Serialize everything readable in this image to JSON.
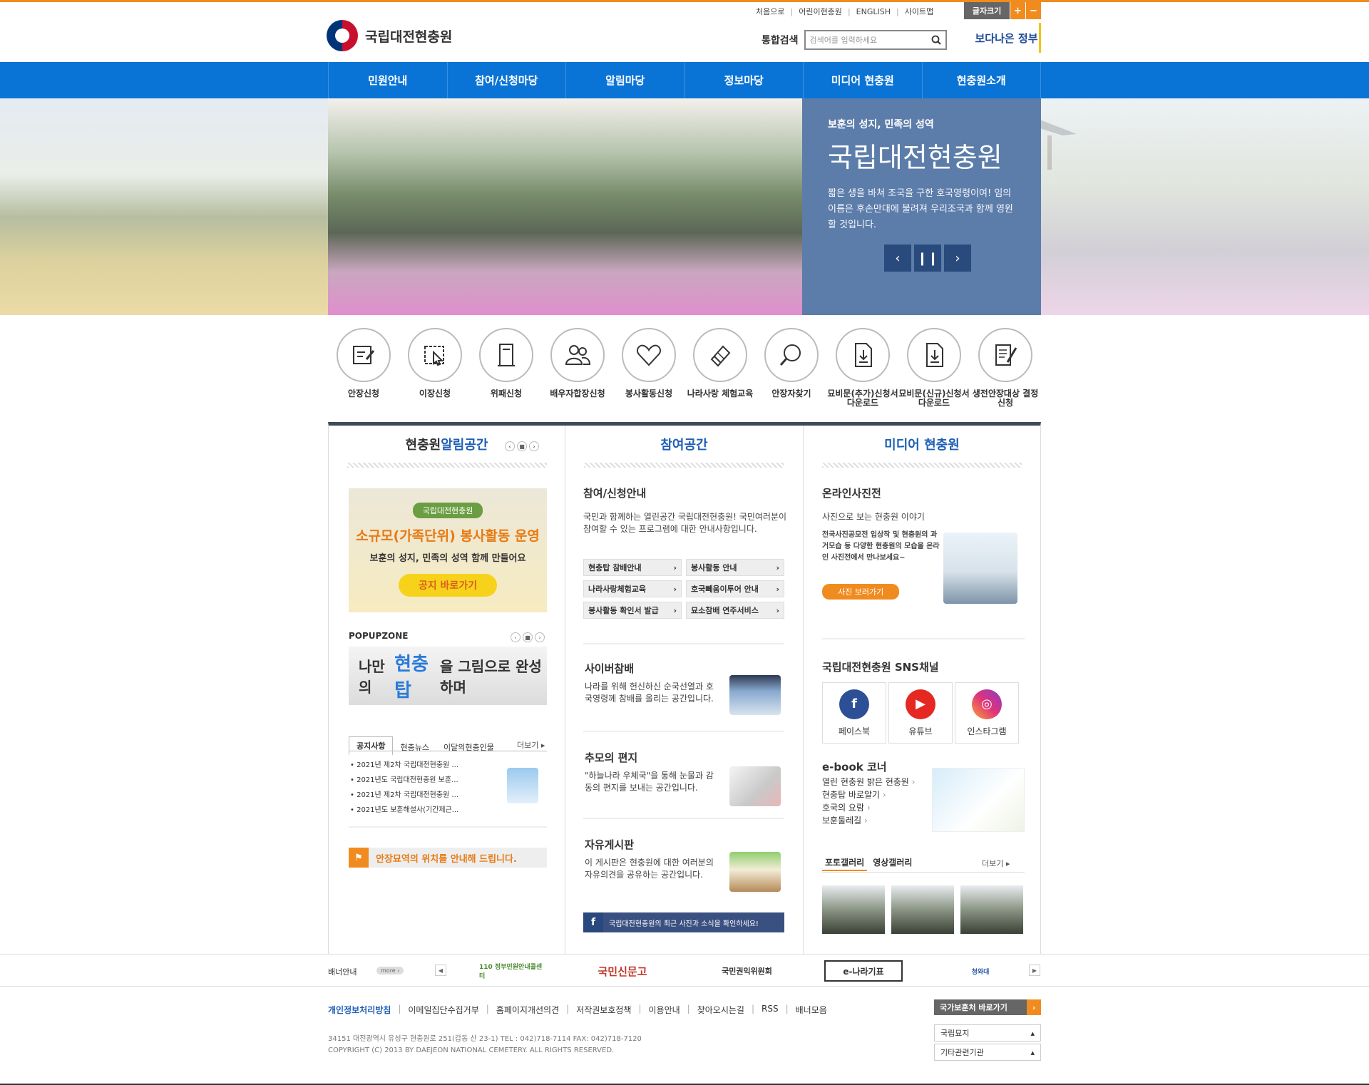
{
  "util": {
    "links": [
      "처음으로",
      "어린이현충원",
      "ENGLISH",
      "사이트맵"
    ],
    "font_size_label": "글자크기",
    "plus": "+",
    "minus": "−"
  },
  "site": {
    "name": "국립대전현충원"
  },
  "search": {
    "label": "통합검색",
    "placeholder": "검색어를 입력하세요"
  },
  "gov_badge": "보다나은 정부",
  "nav": [
    "민원안내",
    "참여/신청마당",
    "알림마당",
    "정보마당",
    "미디어 현충원",
    "현충원소개"
  ],
  "hero": {
    "subtitle": "보훈의 성지, 민족의 성역",
    "title": "국립대전현충원",
    "desc": "짧은 생을 바쳐 조국을 구한 호국영령이여! 임의 이름은 후손만대에 불려져 우리조국과 함께 영원할 것입니다.",
    "prev": "‹",
    "pause": "❙❙",
    "next": "›"
  },
  "quick_links": [
    "안장신청",
    "이장신청",
    "위패신청",
    "배우자합장신청",
    "봉사활동신청",
    "나라사랑 체험교육",
    "안장자찾기",
    "묘비문(추가)신청서 다운로드",
    "묘비문(신규)신청서 다운로드",
    "생전안장대상 결정신청"
  ],
  "col1": {
    "title_a": "현충원 ",
    "title_b": "알림공간",
    "banner": {
      "tag": "국립대전현충원",
      "headline": "소규모(가족단위) 봉사활동 운영",
      "sub": "보훈의 성지, 민족의 성역 함께 만들어요",
      "button": "공지 바로가기"
    },
    "popup_title": "POPUPZONE",
    "popup": {
      "a": "나만의",
      "b": "현충탑",
      "c": "을 그림으로 완성하며"
    },
    "tabs": [
      "공지사항",
      "현충뉴스",
      "이달의현충인물"
    ],
    "more": "더보기 ▸",
    "notices": [
      "2021년 제2차 국립대전현충원 ...",
      "2021년도 국립대전현충원 보훈...",
      "2021년 제2차 국립대전현충원 ...",
      "2021년도 보훈해설사(기간제근..."
    ],
    "location": "안장묘역의 위치를 안내해 드립니다."
  },
  "col2": {
    "title": "참여공간",
    "guide_title": "참여/신청안내",
    "guide_desc": "국민과 함께하는 열린공간 국립대전현충원! 국민여러분이 참여할 수 있는 프로그램에 대한 안내사항입니다.",
    "buttons": [
      "현충탑 참배안내",
      "봉사활동 안내",
      "나라사랑체험교육",
      "호국뻬움이투어 안내",
      "봉사활동 확인서 발급",
      "묘소참배 연주서비스"
    ],
    "cyber_title": "사이버참배",
    "cyber_desc": "나라를 위해 헌신하신 순국선열과 호국영령께 참배를 올리는 공간입니다.",
    "letter_title": "추모의 편지",
    "letter_desc": "\"하늘나라 우체국\"을 통해 눈물과 감동의 편지를 보내는 공간입니다.",
    "board_title": "자유게시판",
    "board_desc": "이 게시판은 현충원에 대한 여러분의 자유의견을 공유하는 공간입니다.",
    "fb_bar": "국립대전현충원의 최근 사진과 소식을 확인하세요!"
  },
  "col3": {
    "title": "미디어 현충원",
    "photo_title": "온라인사진전",
    "photo_sub": "사진으로 보는 현충원 이야기",
    "photo_desc": "전국사진공모전 입상작 및 현충원의 과거모습 등 다양한 현충원의 모습을 온라인 사진전에서 만나보세요~",
    "photo_btn": "사진 보러가기",
    "sns_title": "국립대전현충원 SNS채널",
    "sns": [
      "페이스북",
      "유튜브",
      "인스타그램"
    ],
    "ebook_title": "e-book 코너",
    "ebook_list": [
      "열린 현충원 밝은 현충원",
      "현충탑 바로알기",
      "호국의 요람",
      "보훈둘레길"
    ],
    "gallery_tabs": [
      "포토갤러리",
      "영상갤러리"
    ],
    "more": "더보기 ▸"
  },
  "banner_bar": {
    "label": "배너안내",
    "more": "more ›",
    "items": [
      "110 정부민원안내콜센터",
      "국민신문고",
      "국민권익위원회",
      "e-나라기표",
      "청와대"
    ]
  },
  "footer": {
    "links": [
      "개인정보처리방침",
      "이메일집단수집거부",
      "홈페이지개선의견",
      "저작권보호정책",
      "이용안내",
      "찾아오시는길",
      "RSS",
      "배너모음"
    ],
    "site_btn": "국가보훈처 바로가기",
    "select1": "국립묘지",
    "select2": "기타관련기관",
    "address": "34151 대전광역시 유성구 현충원로 251(갑동 산 23-1) TEL : 042)718-7114 FAX: 042)718-7120",
    "copyright": "COPYRIGHT (C) 2013 BY DAEJEON NATIONAL CEMETERY. ALL RIGHTS RESERVED."
  },
  "colors": {
    "nav": "#0a74d6",
    "accent": "#f08c1f",
    "panel": "#5c7daa"
  }
}
